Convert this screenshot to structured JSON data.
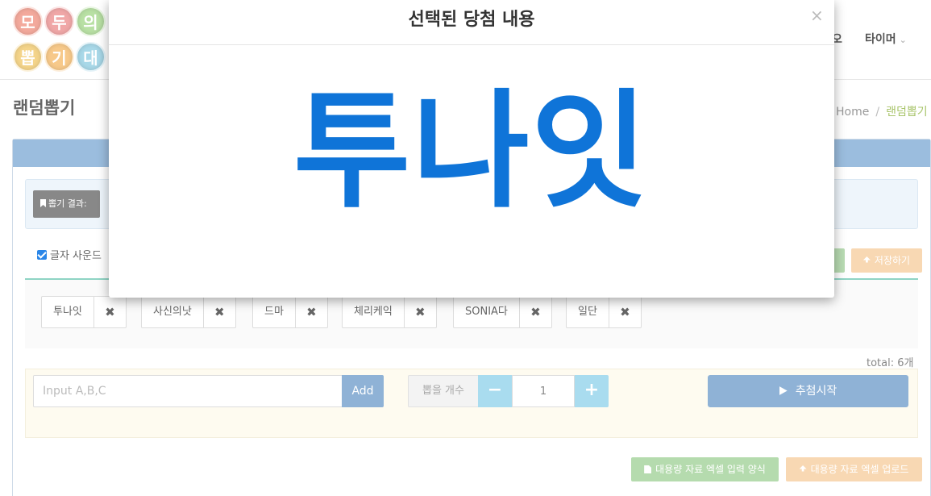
{
  "logo": {
    "chars": [
      {
        "ch": "모",
        "color": "#f3a99c"
      },
      {
        "ch": "두",
        "color": "#f0a7a7"
      },
      {
        "ch": "의",
        "color": "#b8e0a4"
      },
      {
        "ch": "뽑",
        "color": "#f4d48a"
      },
      {
        "ch": "기",
        "color": "#f7c98a"
      },
      {
        "ch": "대",
        "color": "#a8d8e8"
      }
    ]
  },
  "topnav": {
    "cut_label": "오",
    "timer_label": "타이머",
    "caret": "⌄"
  },
  "page": {
    "title": "랜덤뽑기",
    "breadcrumb": {
      "home": "Home",
      "sep": "/",
      "current": "랜덤뽑기"
    }
  },
  "result": {
    "label": "뽑기 결과:"
  },
  "options": {
    "sound_label": "글자 사운드"
  },
  "toolbar": {
    "save_label": "저장하기"
  },
  "tags": [
    {
      "name": "투나잇",
      "delete": "✖"
    },
    {
      "name": "사신의낫",
      "delete": "✖"
    },
    {
      "name": "드마",
      "delete": "✖"
    },
    {
      "name": "체리케익",
      "delete": "✖"
    },
    {
      "name": "SONIA다",
      "delete": "✖"
    },
    {
      "name": "일단",
      "delete": "✖"
    }
  ],
  "total": "total: 6개",
  "input": {
    "placeholder": "Input A,B,C",
    "add_label": "Add",
    "count_label": "뽑을 개수",
    "minus": "−",
    "plus": "+",
    "count_value": "1",
    "start_label": "추첨시작"
  },
  "bottom": {
    "excel_form": "대용량 자료 엑셀 입력 양식",
    "excel_upload": "대용량 자료 엑셀 업로드"
  },
  "modal": {
    "title": "선택된 당첨 내용",
    "close": "×",
    "result": "투나잇"
  },
  "colors": {
    "accent_blue": "#0f74d8",
    "button_blue": "#8fb2d6",
    "save_orange": "#f8d8b3",
    "excel_green": "#b5dbae"
  }
}
